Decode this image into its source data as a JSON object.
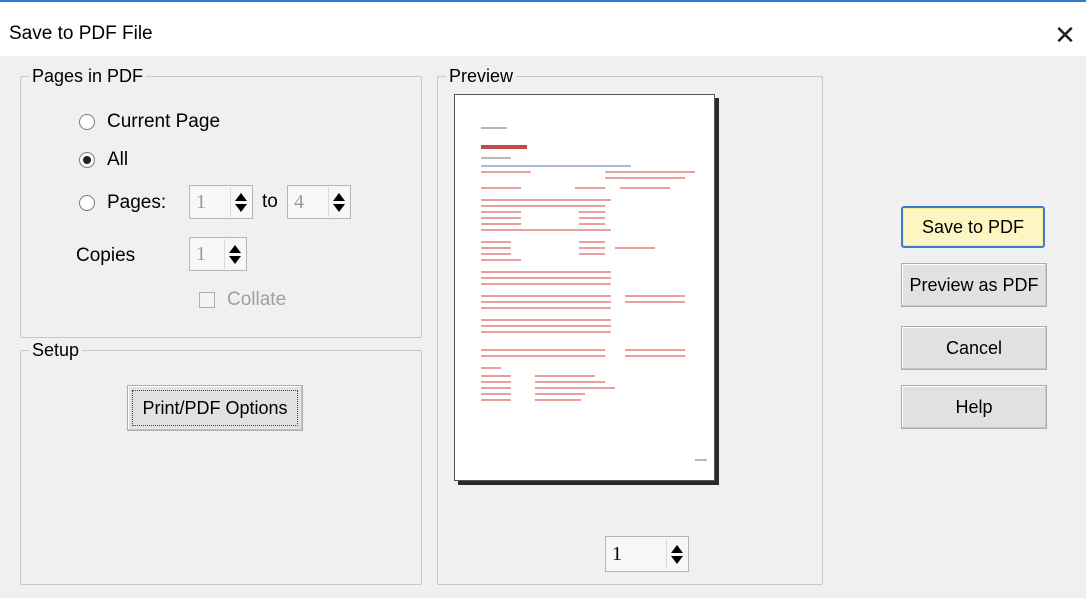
{
  "window": {
    "title": "Save to PDF File",
    "close_glyph": "✕",
    "close_icon": "close-icon"
  },
  "pages_group": {
    "legend": "Pages in PDF",
    "options": {
      "current_page": "Current Page",
      "all": "All",
      "pages": "Pages:"
    },
    "selected": "all",
    "from_value": "1",
    "to_label": "to",
    "to_value": "4",
    "copies_label": "Copies",
    "copies_value": "1",
    "collate_label": "Collate",
    "collate_checked": false
  },
  "setup_group": {
    "legend": "Setup",
    "options_button": "Print/PDF Options"
  },
  "preview_group": {
    "legend": "Preview",
    "page_value": "1"
  },
  "buttons": {
    "save": "Save to PDF",
    "preview": "Preview as PDF",
    "cancel": "Cancel",
    "help": "Help"
  },
  "colors": {
    "accent": "#3f7ad1",
    "default_button": "#fdf6c2"
  }
}
